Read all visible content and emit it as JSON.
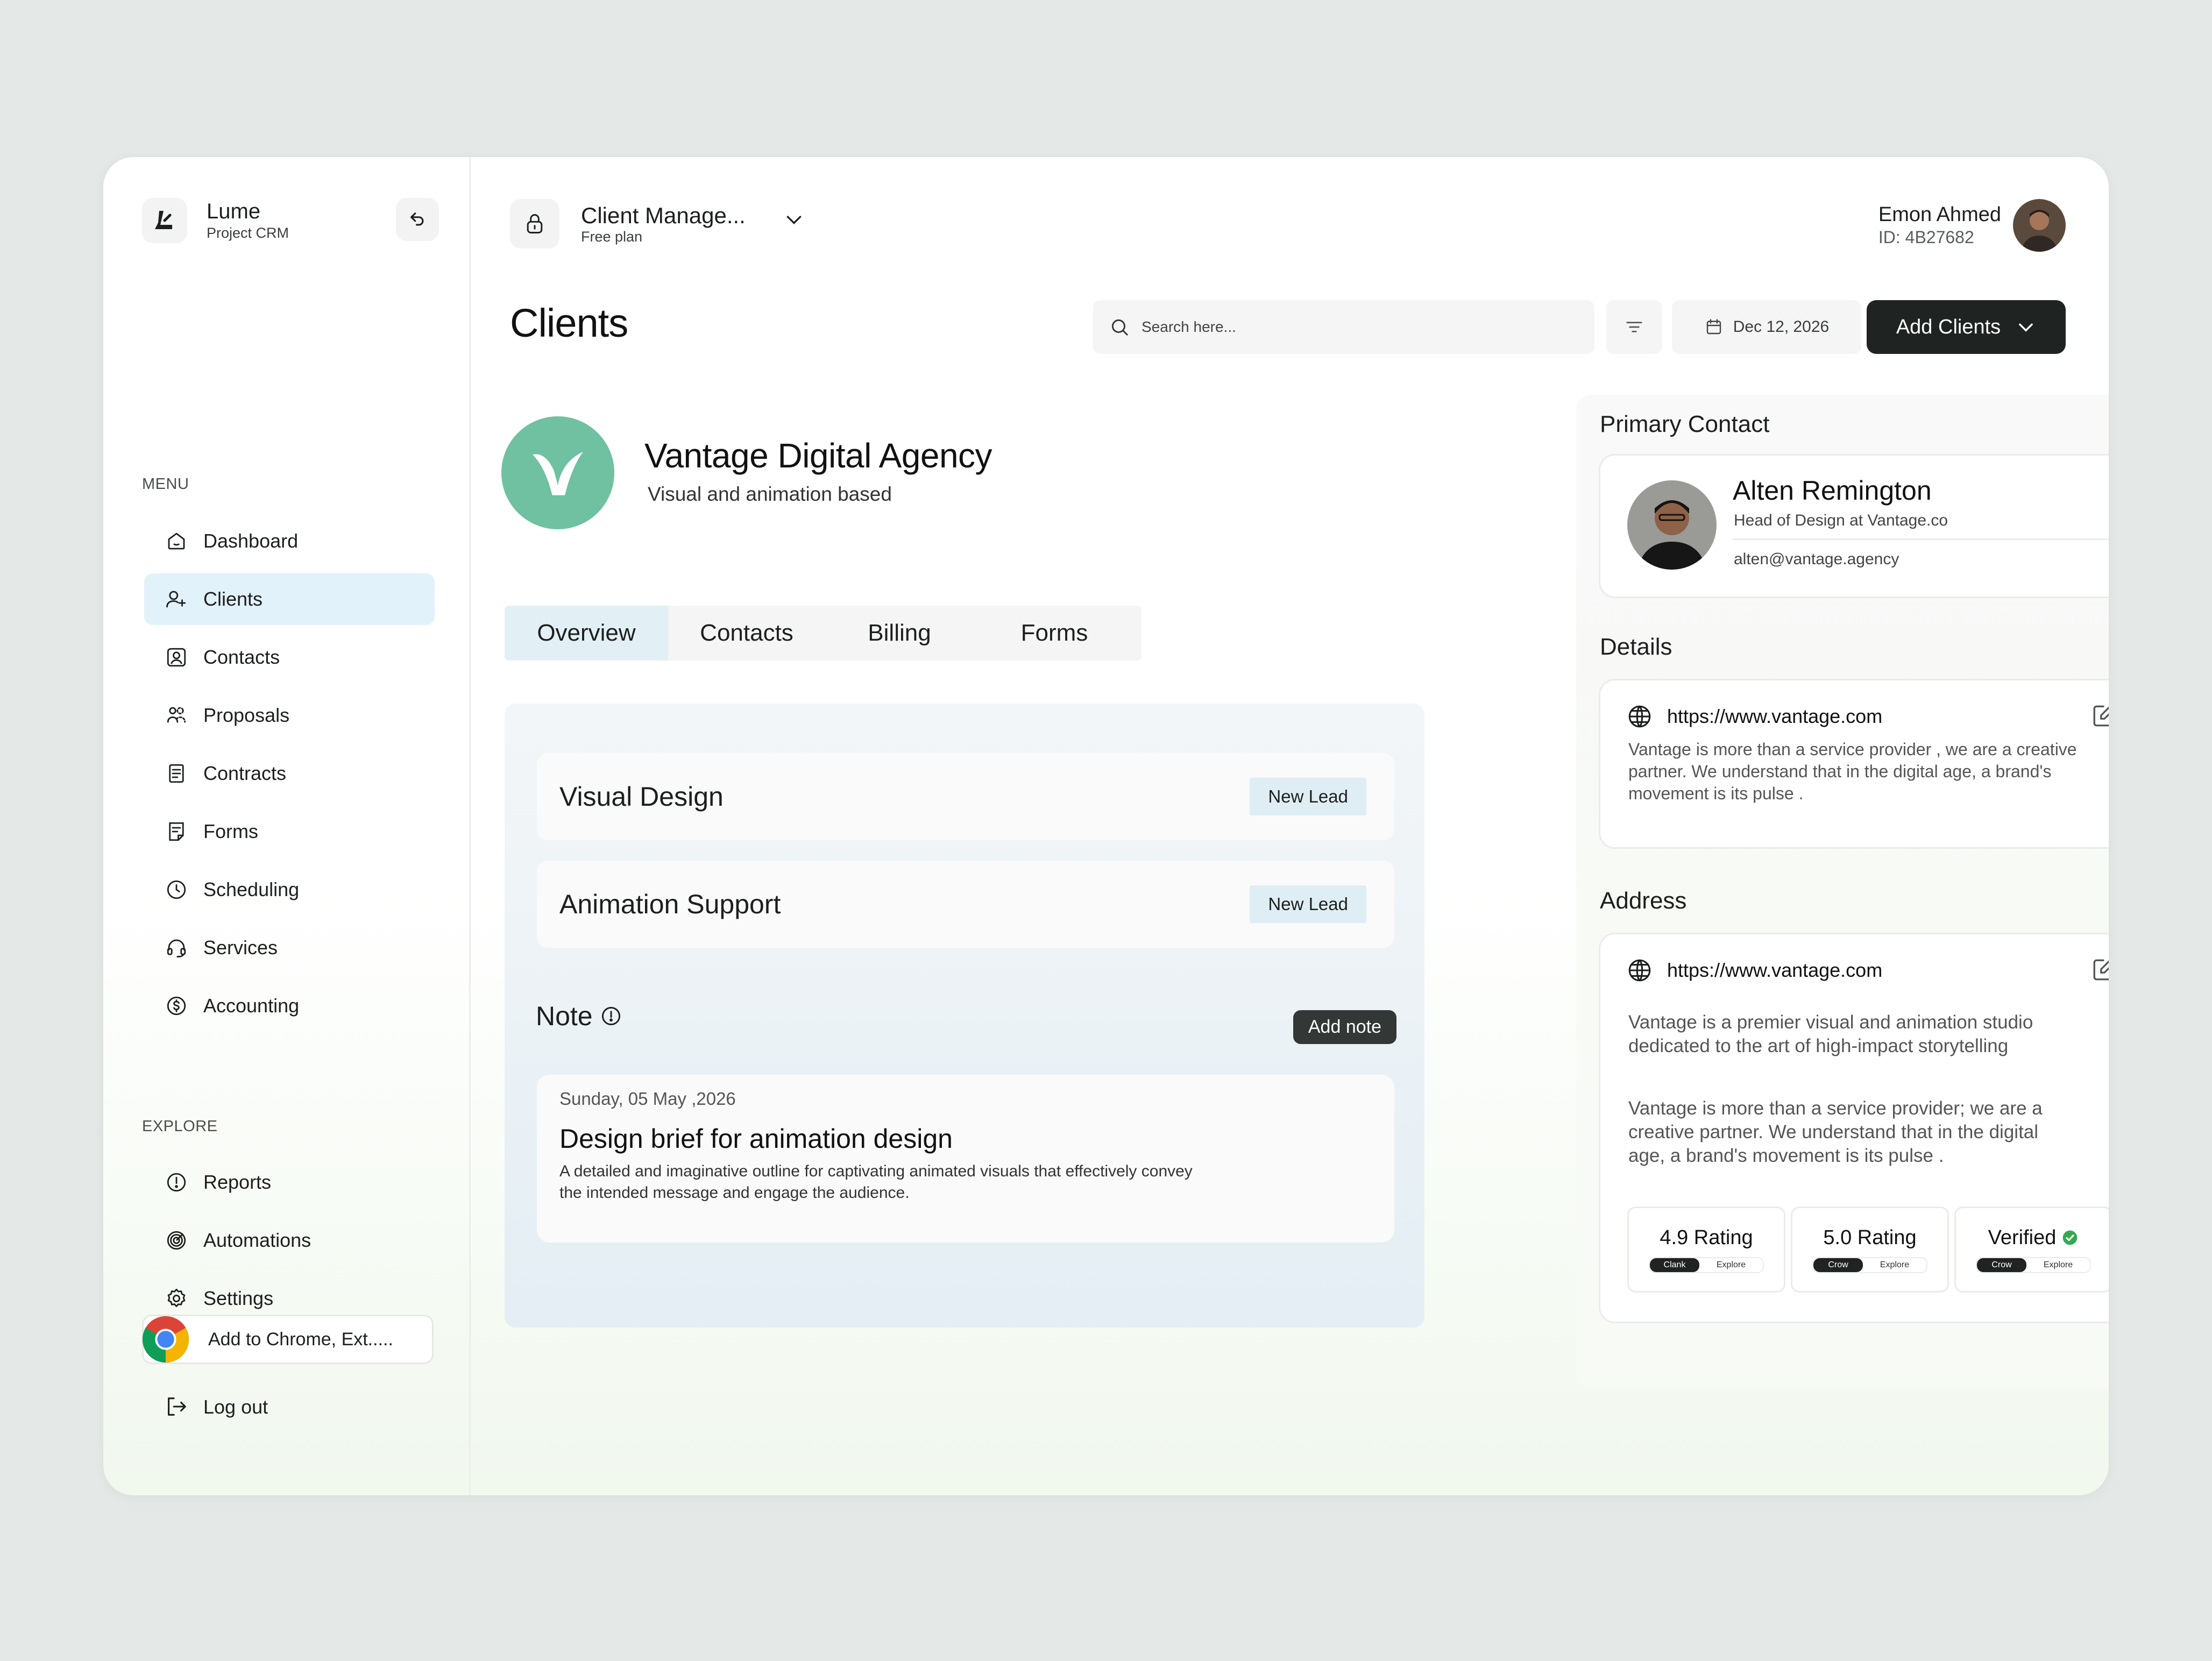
{
  "brand": {
    "name": "Lume",
    "subtitle": "Project CRM"
  },
  "sidebar": {
    "menu_label": "MENU",
    "explore_label": "EXPLORE",
    "menu_items": [
      {
        "label": "Dashboard",
        "icon": "home-icon"
      },
      {
        "label": "Clients",
        "icon": "users-icon",
        "active": true
      },
      {
        "label": "Contacts",
        "icon": "contact-icon"
      },
      {
        "label": "Proposals",
        "icon": "proposals-icon"
      },
      {
        "label": "Contracts",
        "icon": "contract-icon"
      },
      {
        "label": "Forms",
        "icon": "form-icon"
      },
      {
        "label": "Scheduling",
        "icon": "clock-icon"
      },
      {
        "label": "Services",
        "icon": "headset-icon"
      },
      {
        "label": "Accounting",
        "icon": "dollar-icon"
      }
    ],
    "explore_items": [
      {
        "label": "Reports",
        "icon": "alert-icon"
      },
      {
        "label": "Automations",
        "icon": "target-icon"
      },
      {
        "label": "Settings",
        "icon": "gear-icon"
      }
    ],
    "chrome_extension": "Add to Chrome, Ext.....",
    "logout": "Log out"
  },
  "header": {
    "workspace_name": "Client Manage...",
    "workspace_plan": "Free plan",
    "user_name": "Emon Ahmed",
    "user_id": "ID:  4B27682"
  },
  "toolbar": {
    "page_title": "Clients",
    "search_placeholder": "Search here...",
    "date": "Dec 12, 2026",
    "add_button": "Add Clients"
  },
  "client": {
    "name": "Vantage Digital  Agency",
    "description": "Visual and animation based",
    "logo_color": "#6fc1a1"
  },
  "tabs": [
    "Overview",
    "Contacts",
    "Billing",
    "Forms"
  ],
  "overview": {
    "leads": [
      {
        "title": "Visual Design",
        "badge": "New Lead"
      },
      {
        "title": "Animation Support",
        "badge": "New Lead"
      }
    ],
    "note_title": "Note",
    "add_note": "Add note",
    "note": {
      "date": "Sunday, 05 May ,2026",
      "title": "Design brief for animation design",
      "body": "A detailed and imaginative outline for captivating animated visuals that effectively convey the intended message and engage the audience."
    }
  },
  "primary_contact": {
    "section_title": "Primary Contact",
    "name": "Alten Remington",
    "role": "Head of Design at Vantage.co",
    "email": "alten@vantage.agency"
  },
  "details": {
    "section_title": "Details",
    "url": "https://www.vantage.com",
    "text": "Vantage is more than a service provider , we are a creative partner. We understand that in the digital age, a brand's movement is its pulse ."
  },
  "address": {
    "section_title": "Address",
    "url": "https://www.vantage.com",
    "text1": "Vantage is a premier visual and animation studio dedicated to the art of high-impact storytelling",
    "text2": "Vantage is more than a service provider; we are a creative partner. We understand that in the digital age, a brand's movement is its pulse .",
    "ratings": [
      {
        "label": "4.9 Rating",
        "chip": "Clank",
        "action": "Explore"
      },
      {
        "label": "5.0 Rating",
        "chip": "Crow",
        "action": "Explore"
      },
      {
        "label": "Verified",
        "chip": "Crow",
        "action": "Explore",
        "verified": true
      }
    ]
  },
  "colors": {
    "accent_dark": "#1f2322",
    "active_nav": "#e2f2fb",
    "verified": "#34a853"
  }
}
